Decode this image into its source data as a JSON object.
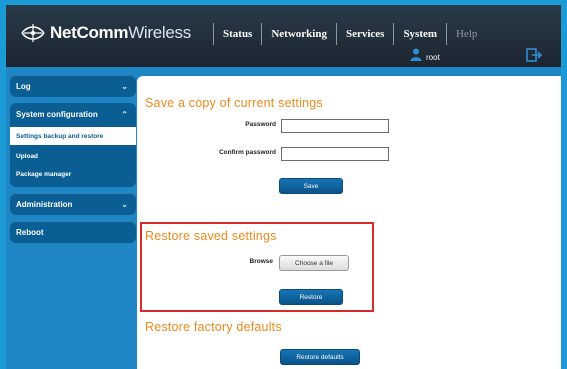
{
  "brand": {
    "name_bold": "NetComm",
    "name_light": "Wireless"
  },
  "nav": {
    "items": [
      {
        "label": "Status"
      },
      {
        "label": "Networking"
      },
      {
        "label": "Services"
      },
      {
        "label": "System"
      },
      {
        "label": "Help"
      }
    ]
  },
  "user": {
    "name": "root"
  },
  "sidebar": {
    "log": "Log",
    "system_configuration": "System configuration",
    "sub_items": [
      {
        "label": "Settings backup and restore",
        "active": true
      },
      {
        "label": "Upload",
        "active": false
      },
      {
        "label": "Package manager",
        "active": false
      }
    ],
    "administration": "Administration",
    "reboot": "Reboot"
  },
  "save_section": {
    "title": "Save a copy of current settings",
    "password_label": "Password",
    "confirm_label": "Confirm password",
    "password_value": "",
    "confirm_value": "",
    "save_button": "Save"
  },
  "restore_section": {
    "title": "Restore saved settings",
    "browse_label": "Browse",
    "choose_file_button": "Choose a file",
    "restore_button": "Restore"
  },
  "factory_section": {
    "title": "Restore factory defaults",
    "restore_defaults_button": "Restore defaults"
  },
  "colors": {
    "accent_orange": "#f08a1c",
    "nav_blue": "#0b5e94",
    "highlight_red": "#d92a2a"
  }
}
